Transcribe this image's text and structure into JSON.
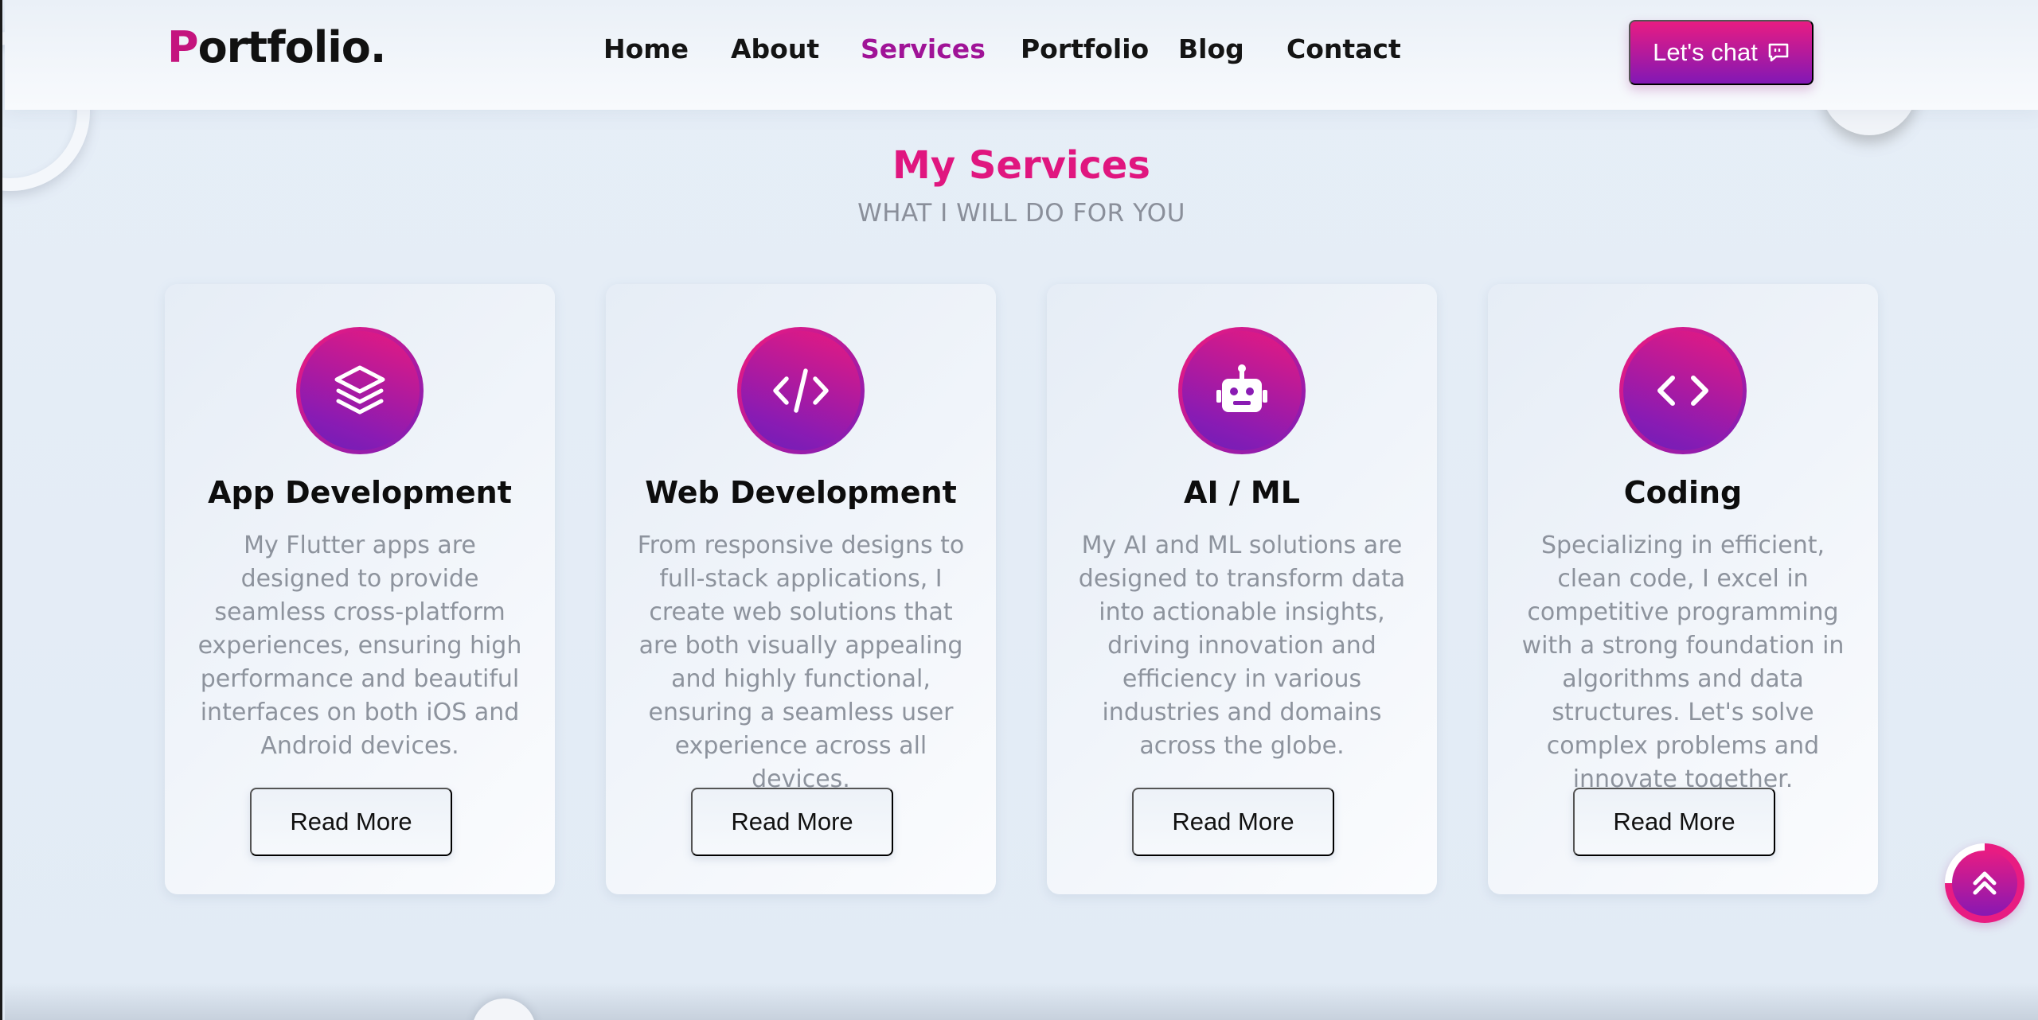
{
  "header": {
    "logo_first": "P",
    "logo_rest": "ortfolio.",
    "nav": [
      "Home",
      "About",
      "Services",
      "Portfolio",
      "Blog",
      "Contact"
    ],
    "active_nav": "Services",
    "chat_button": "Let's chat",
    "chat_icon": "chat-bubble-icon"
  },
  "section": {
    "title": "My Services",
    "subtitle": "WHAT I WILL DO FOR YOU"
  },
  "cards": [
    {
      "icon": "layers-icon",
      "title": "App Development",
      "description": "My Flutter apps are designed to provide seamless cross-platform experiences, ensuring high performance and beautiful interfaces on both iOS and Android devices.",
      "button": "Read More"
    },
    {
      "icon": "code-slash-icon",
      "title": "Web Development",
      "description": "From responsive designs to full-stack applications, I create web solutions that are both visually appealing and highly functional, ensuring a seamless user experience across all devices.",
      "button": "Read More"
    },
    {
      "icon": "robot-icon",
      "title": "AI / ML",
      "description": "My AI and ML solutions are designed to transform data into actionable insights, driving innovation and efficiency in various industries and domains across the globe.",
      "button": "Read More"
    },
    {
      "icon": "code-brackets-icon",
      "title": "Coding",
      "description": "Specializing in efficient, clean code, I excel in competitive programming with a strong foundation in algorithms and data structures. Let's solve complex problems and innovate together.",
      "button": "Read More"
    }
  ],
  "scroll_top": {
    "icon": "double-chevron-up-icon",
    "progress": 0.75
  },
  "colors": {
    "accent_pink": "#e0167f",
    "accent_purple": "#8218b5",
    "active_nav": "#a01397",
    "background": "#e3ecf5"
  }
}
